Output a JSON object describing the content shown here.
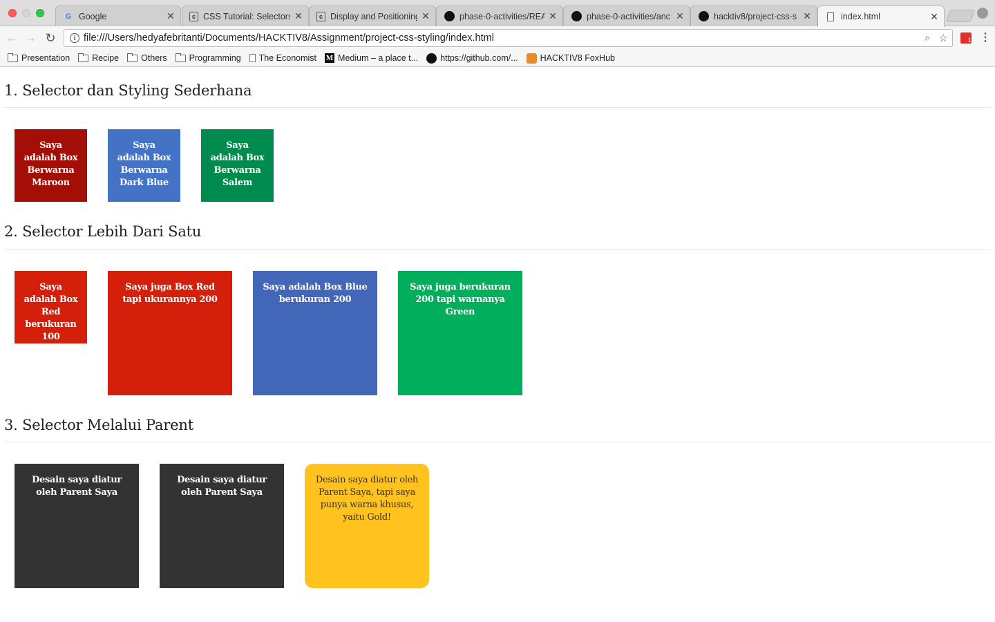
{
  "browser": {
    "tabs": [
      {
        "title": "Google",
        "icon": "google-icon"
      },
      {
        "title": "CSS Tutorial: Selectors",
        "icon": "codecademy-icon"
      },
      {
        "title": "Display and Positioning",
        "icon": "codecademy-icon"
      },
      {
        "title": "phase-0-activities/REA",
        "icon": "github-icon"
      },
      {
        "title": "phase-0-activities/anc",
        "icon": "github-icon"
      },
      {
        "title": "hacktiv8/project-css-s",
        "icon": "github-icon"
      },
      {
        "title": "index.html",
        "icon": "page-icon"
      }
    ],
    "address": "file:///Users/hedyafebritanti/Documents/HACKTIV8/Assignment/project-css-styling/index.html",
    "extension_badge": "1",
    "bookmarks": [
      {
        "label": "Presentation",
        "icon": "folder-icon"
      },
      {
        "label": "Recipe",
        "icon": "folder-icon"
      },
      {
        "label": "Others",
        "icon": "folder-icon"
      },
      {
        "label": "Programming",
        "icon": "folder-icon"
      },
      {
        "label": "The Economist",
        "icon": "page-icon"
      },
      {
        "label": "Medium – a place t...",
        "icon": "medium-icon"
      },
      {
        "label": "https://github.com/...",
        "icon": "github-icon"
      },
      {
        "label": "HACKTIV8 FoxHub",
        "icon": "foxhub-icon"
      }
    ]
  },
  "page": {
    "sections": [
      {
        "title": "1. Selector dan Styling Sederhana",
        "boxes": [
          {
            "text": "Saya adalah Box Berwarna Maroon",
            "color": "#a30f06"
          },
          {
            "text": "Saya adalah Box Berwarna Dark Blue",
            "color": "#4472c4"
          },
          {
            "text": "Saya adalah Box Berwarna Salem",
            "color": "#008a4e"
          }
        ]
      },
      {
        "title": "2. Selector Lebih Dari Satu",
        "boxes": [
          {
            "text": "Saya adalah Box Red berukuran 100",
            "color": "#d41f0a"
          },
          {
            "text": "Saya juga Box Red tapi ukurannya 200",
            "color": "#d41f0a"
          },
          {
            "text": "Saya adalah Box Blue berukuran 200",
            "color": "#4266b8"
          },
          {
            "text": "Saya juga berukuran 200 tapi warnanya Green",
            "color": "#00ae5c"
          }
        ]
      },
      {
        "title": "3. Selector Melalui Parent",
        "boxes": [
          {
            "text": "Desain saya diatur oleh Parent Saya",
            "color": "#333333"
          },
          {
            "text": "Desain saya diatur oleh Parent Saya",
            "color": "#333333"
          },
          {
            "text": "Desain saya diatur oleh Parent Saya, tapi saya punya warna khusus, yaitu Gold!",
            "color": "#ffc21f",
            "text_color": "#333333"
          }
        ]
      }
    ]
  }
}
